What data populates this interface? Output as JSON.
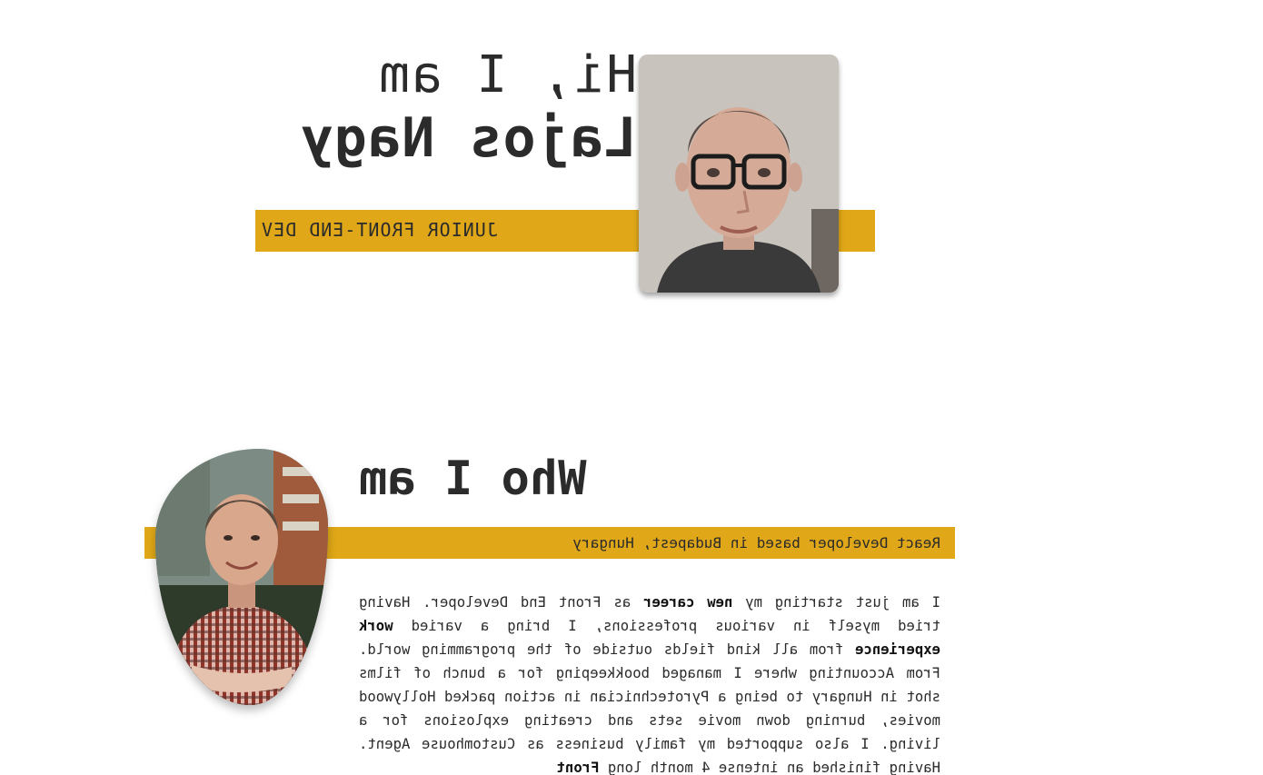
{
  "hero": {
    "greeting": "Hi, I am",
    "name": "Lajos Nagy",
    "role": "JUNIOR FRONT-END DEV",
    "accent_color": "#e0a818"
  },
  "about": {
    "title": "Who I am",
    "tagline": "React Developer based in Budapest, Hungary",
    "paragraph": [
      {
        "t": "I am just starting my ",
        "b": false
      },
      {
        "t": "new career",
        "b": true
      },
      {
        "t": " as Front End Developer. Having tried myself in various professions, I bring a varied ",
        "b": false
      },
      {
        "t": "work experience",
        "b": true
      },
      {
        "t": " from all kind fields outside of the programming world. From Accounting where I managed bookkeeping for a bunch of films shot in Hungary to being a Pyrotechnician in action packed Hollywood movies, burning down movie sets and creating explosions for a living. I also supported my family business as Customhouse Agent. Having finished an intense 4 month long ",
        "b": false
      },
      {
        "t": "Front",
        "b": true
      }
    ]
  }
}
